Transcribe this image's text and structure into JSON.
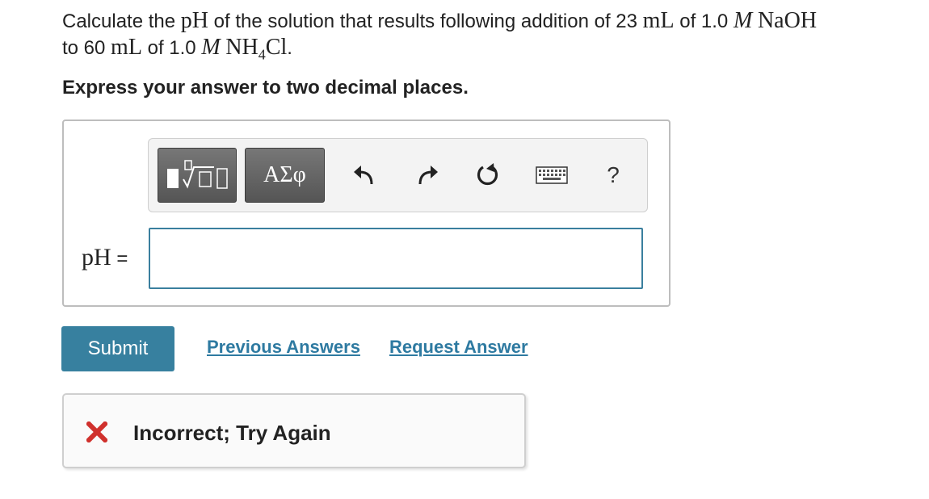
{
  "question": {
    "part1": "Calculate the ",
    "ph": "pH",
    "part2": " of the solution that results following addition of 23 ",
    "ml1": "mL",
    "part3": " of 1.0 ",
    "m1": "M",
    "naoh": "NaOH",
    "part4": "to 60 ",
    "ml2": "mL",
    "part5": " of 1.0 ",
    "m2": "M",
    "nh": "NH",
    "sub4": "4",
    "cl": "Cl",
    "period": "."
  },
  "instruction": "Express your answer to two decimal places.",
  "toolbar": {
    "greek_label": "ΑΣφ",
    "help_label": "?",
    "icons": [
      "templates-icon",
      "greek-icon",
      "undo-icon",
      "redo-icon",
      "reset-icon",
      "keyboard-icon",
      "help-icon"
    ]
  },
  "answer": {
    "label": "pH",
    "equals": " =",
    "value": ""
  },
  "actions": {
    "submit_label": "Submit",
    "previous_answers_label": "Previous Answers",
    "request_answer_label": "Request Answer"
  },
  "feedback": {
    "text": "Incorrect; Try Again",
    "icon": "x-icon"
  },
  "colors": {
    "primary": "#37809f",
    "link": "#2e7aa1",
    "error": "#d0312d",
    "input_border": "#3a7f9e"
  }
}
